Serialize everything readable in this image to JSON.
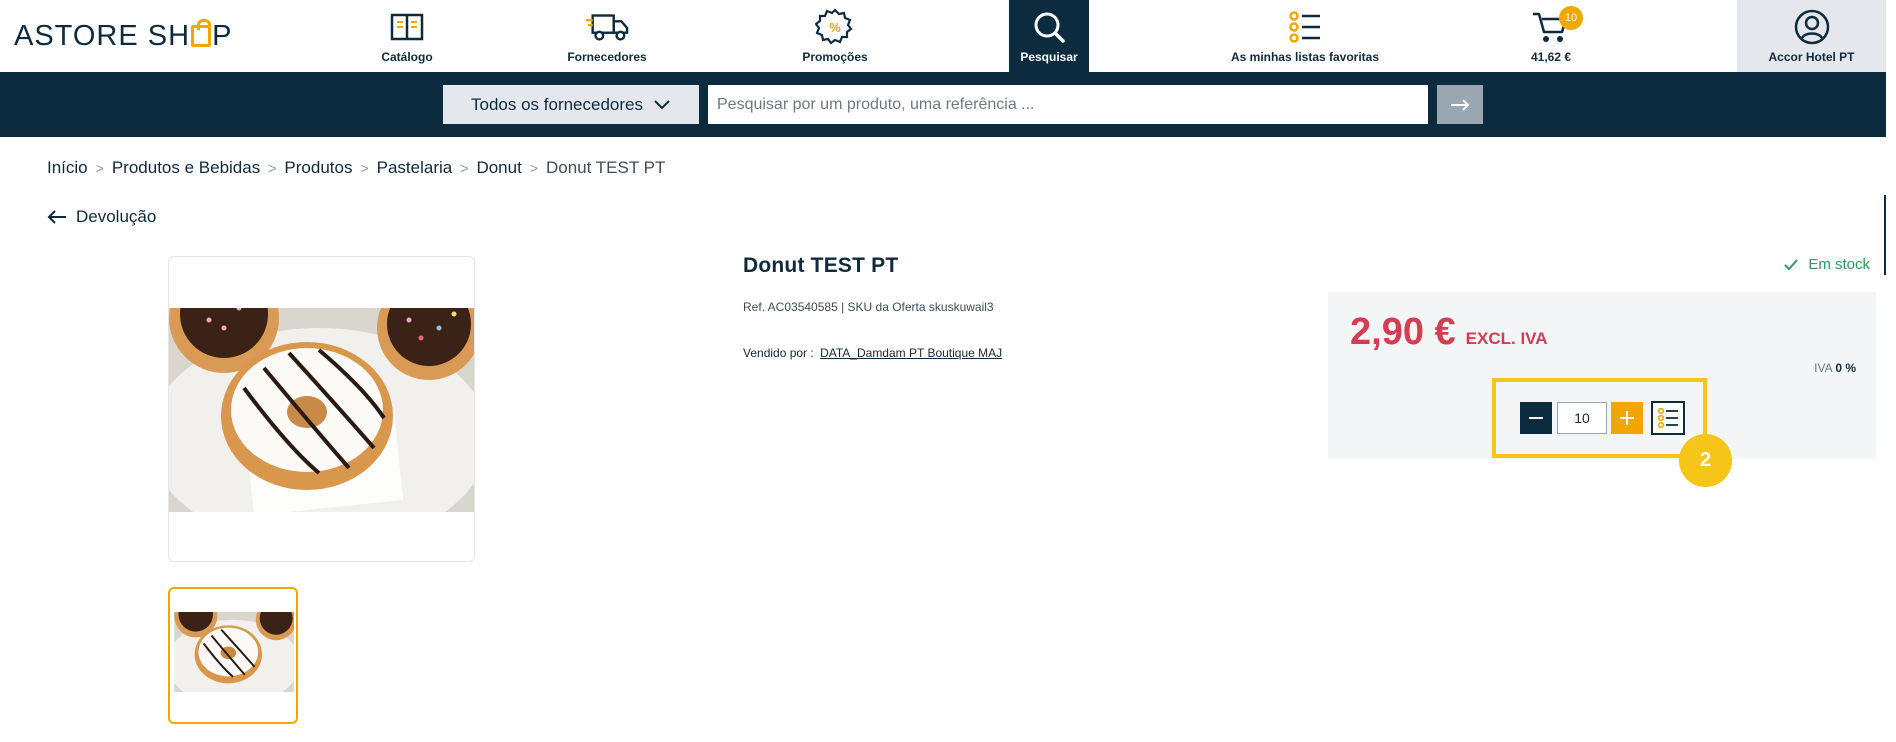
{
  "header": {
    "logo_text_1": "ASTORE SH",
    "logo_text_2": "P",
    "nav": {
      "catalog": "Catálogo",
      "suppliers": "Fornecedores",
      "promotions": "Promoções",
      "search": "Pesquisar",
      "favorites": "As minhas listas favoritas",
      "cart_total": "41,62 €",
      "cart_count": "10",
      "account": "Accor Hotel PT"
    }
  },
  "search": {
    "supplier_select": "Todos os fornecedores",
    "placeholder": "Pesquisar por um produto, uma referência ..."
  },
  "breadcrumb": [
    "Início",
    "Produtos e Bebidas",
    "Produtos",
    "Pastelaria",
    "Donut",
    "Donut TEST PT"
  ],
  "back_label": "Devolução",
  "product": {
    "title": "Donut TEST PT",
    "ref": "Ref. AC03540585 | SKU da Oferta skuskuwail3",
    "sold_by_label": "Vendido por :",
    "seller": "DATA_Damdam PT Boutique MAJ",
    "stock": "Em stock",
    "price": "2,90 €",
    "price_unit": "EXCL. IVA",
    "vat_label": "IVA",
    "vat_value": "0 %",
    "quantity": "10"
  },
  "step_marker": "2",
  "colors": {
    "navy": "#0d2b3e",
    "accent": "#f0a800",
    "price": "#d43d52",
    "stock": "#2d9b5a",
    "highlight": "#f5c518"
  }
}
